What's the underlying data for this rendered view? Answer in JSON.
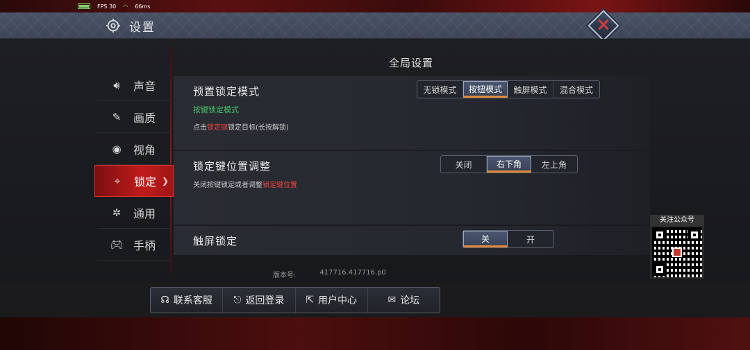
{
  "status": {
    "fps": "FPS 30",
    "ping": "66ms"
  },
  "header": {
    "title": "设置"
  },
  "sidebar": {
    "items": [
      {
        "label": "声音"
      },
      {
        "label": "画质"
      },
      {
        "label": "视角"
      },
      {
        "label": "锁定",
        "active": true
      },
      {
        "label": "通用"
      },
      {
        "label": "手柄"
      }
    ]
  },
  "main": {
    "section_title": "全局设置",
    "preset_lock": {
      "label": "预置锁定模式",
      "options": [
        "无锁模式",
        "按钮模式",
        "触屏模式",
        "混合模式"
      ],
      "selected": "按钮模式",
      "mode_name": "按键锁定模式",
      "desc_prefix": "点击",
      "desc_highlight": "锁定键",
      "desc_suffix": "锁定目标(长按解锁)"
    },
    "lock_key_position": {
      "label": "锁定键位置调整",
      "options": [
        "关闭",
        "右下角",
        "左上角"
      ],
      "selected": "右下角",
      "desc_prefix": "关闭按键锁定或者调整",
      "desc_highlight": "锁定键位置"
    },
    "touch_lock": {
      "label": "触屏锁定",
      "options": [
        "关",
        "开"
      ],
      "selected": "关"
    }
  },
  "version": {
    "label": "版本号:",
    "value": "417716.417716.p0"
  },
  "bottom_nav": {
    "items": [
      {
        "label": "联系客服",
        "icon": "headset-icon"
      },
      {
        "label": "返回登录",
        "icon": "return-icon"
      },
      {
        "label": "用户中心",
        "icon": "share-icon"
      },
      {
        "label": "论坛",
        "icon": "chat-icon"
      }
    ]
  },
  "qr": {
    "label": "关注公众号"
  },
  "colors": {
    "accent_red": "#c01b1b",
    "highlight_green": "#46c26a",
    "tab_underline": "#e08a3a"
  }
}
